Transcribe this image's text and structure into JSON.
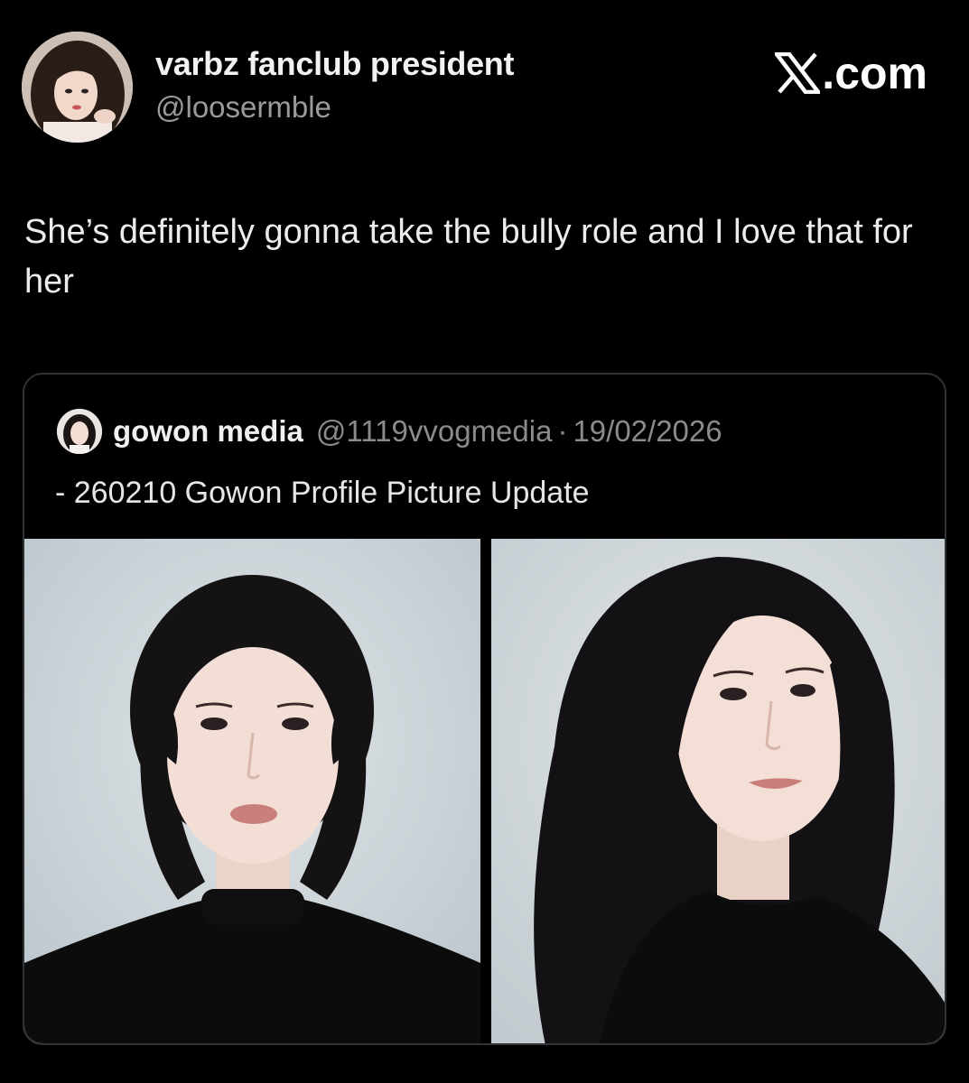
{
  "tweet": {
    "display_name": "varbz fanclub president",
    "handle": "@loosermble",
    "brand_label": ".com",
    "brand_icon": "x-logo-icon",
    "text": "She’s definitely gonna take the bully role and I love that for her"
  },
  "quoted_tweet": {
    "display_name": "gowon media",
    "handle": "@1119vvogmedia",
    "separator": "·",
    "date": "19/02/2026",
    "text": "- 260210 Gowon Profile Picture Update",
    "photos": [
      {
        "subject": "portrait-front"
      },
      {
        "subject": "portrait-angled"
      }
    ]
  },
  "colors": {
    "background": "#000000",
    "primary_text": "#e7e9ea",
    "secondary_text": "#8b8b8b",
    "card_border": "#303336"
  }
}
